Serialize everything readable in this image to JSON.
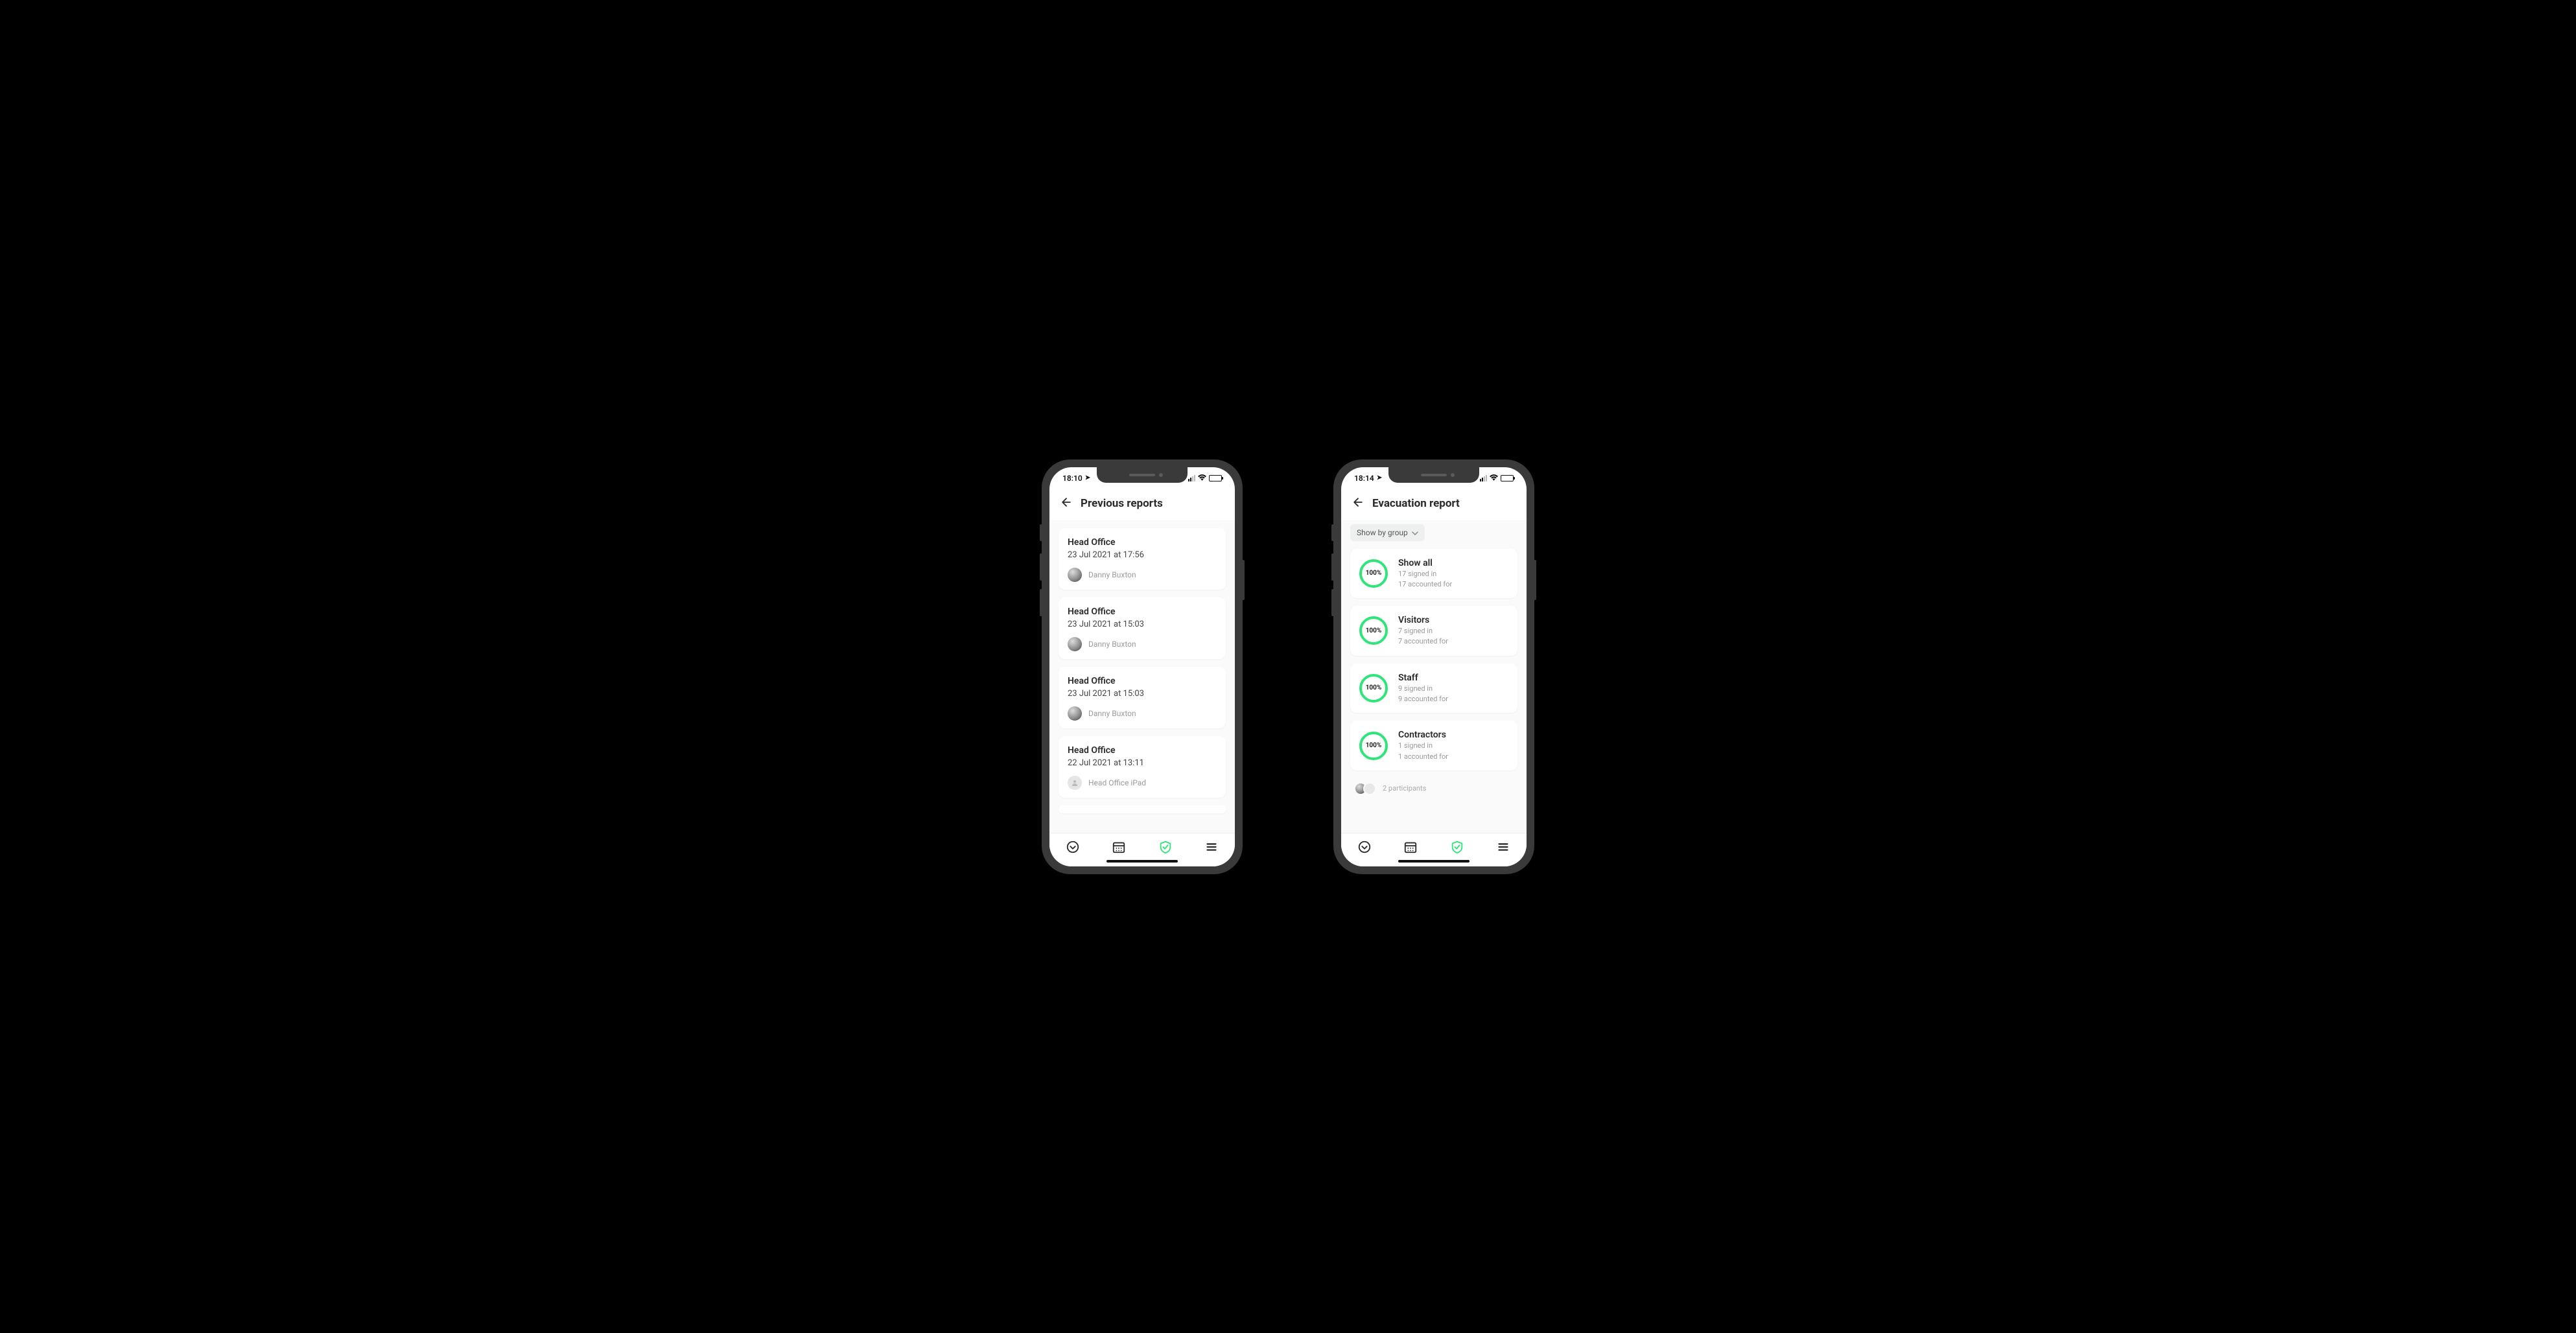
{
  "phone1": {
    "status_time": "18:10",
    "header_title": "Previous reports",
    "reports": [
      {
        "location": "Head Office",
        "datetime": "23 Jul 2021 at 17:56",
        "author": "Danny Buxton",
        "avatar": "photo"
      },
      {
        "location": "Head Office",
        "datetime": "23 Jul 2021 at 15:03",
        "author": "Danny Buxton",
        "avatar": "photo"
      },
      {
        "location": "Head Office",
        "datetime": "23 Jul 2021 at 15:03",
        "author": "Danny Buxton",
        "avatar": "photo"
      },
      {
        "location": "Head Office",
        "datetime": "22 Jul 2021 at 13:11",
        "author": "Head Office iPad",
        "avatar": "blank"
      }
    ]
  },
  "phone2": {
    "status_time": "18:14",
    "header_title": "Evacuation report",
    "filter_label": "Show by group",
    "groups": [
      {
        "percent": "100%",
        "title": "Show all",
        "signed_in": "17 signed in",
        "accounted": "17 accounted for"
      },
      {
        "percent": "100%",
        "title": "Visitors",
        "signed_in": "7 signed in",
        "accounted": "7 accounted for"
      },
      {
        "percent": "100%",
        "title": "Staff",
        "signed_in": "9 signed in",
        "accounted": "9 accounted for"
      },
      {
        "percent": "100%",
        "title": "Contractors",
        "signed_in": "1 signed in",
        "accounted": "1 accounted for"
      }
    ],
    "participants_label": "2 participants"
  }
}
